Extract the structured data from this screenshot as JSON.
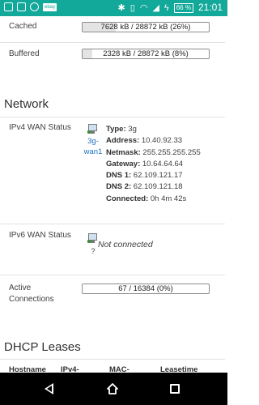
{
  "statusbar": {
    "ebay_label": "ebay",
    "battery": "66 %",
    "time": "21:01"
  },
  "memory": [
    {
      "label": "Cached",
      "value": "7628 kB / 28872 kB (26%)",
      "fraction": 0.26
    },
    {
      "label": "Buffered",
      "value": "2328 kB / 28872 kB (8%)",
      "fraction": 0.08
    }
  ],
  "network": {
    "title": "Network",
    "ipv4": {
      "label": "IPv4 WAN Status",
      "iface_line1": "3g-",
      "iface_line2": "wan1",
      "details": [
        {
          "k": "Type:",
          "v": "3g"
        },
        {
          "k": "Address:",
          "v": "10.40.92.33"
        },
        {
          "k": "Netmask:",
          "v": "255.255.255.255"
        },
        {
          "k": "Gateway:",
          "v": "10.64.64.64"
        },
        {
          "k": "DNS 1:",
          "v": "62.109.121.17"
        },
        {
          "k": "DNS 2:",
          "v": "62.109.121.18"
        },
        {
          "k": "Connected:",
          "v": "0h 4m 42s"
        }
      ]
    },
    "ipv6": {
      "label": "IPv6 WAN Status",
      "iface_placeholder": "?",
      "status": "Not connected"
    },
    "active_connections": {
      "label": "Active Connections",
      "value": "67 / 16384 (0%)",
      "fraction": 0.0
    }
  },
  "dhcp": {
    "title": "DHCP Leases",
    "columns": [
      "Hostname",
      "IPv4-",
      "MAC-",
      "Leasetime"
    ]
  },
  "colors": {
    "status_bar": "#12a89a",
    "link": "#1f6fbf"
  }
}
